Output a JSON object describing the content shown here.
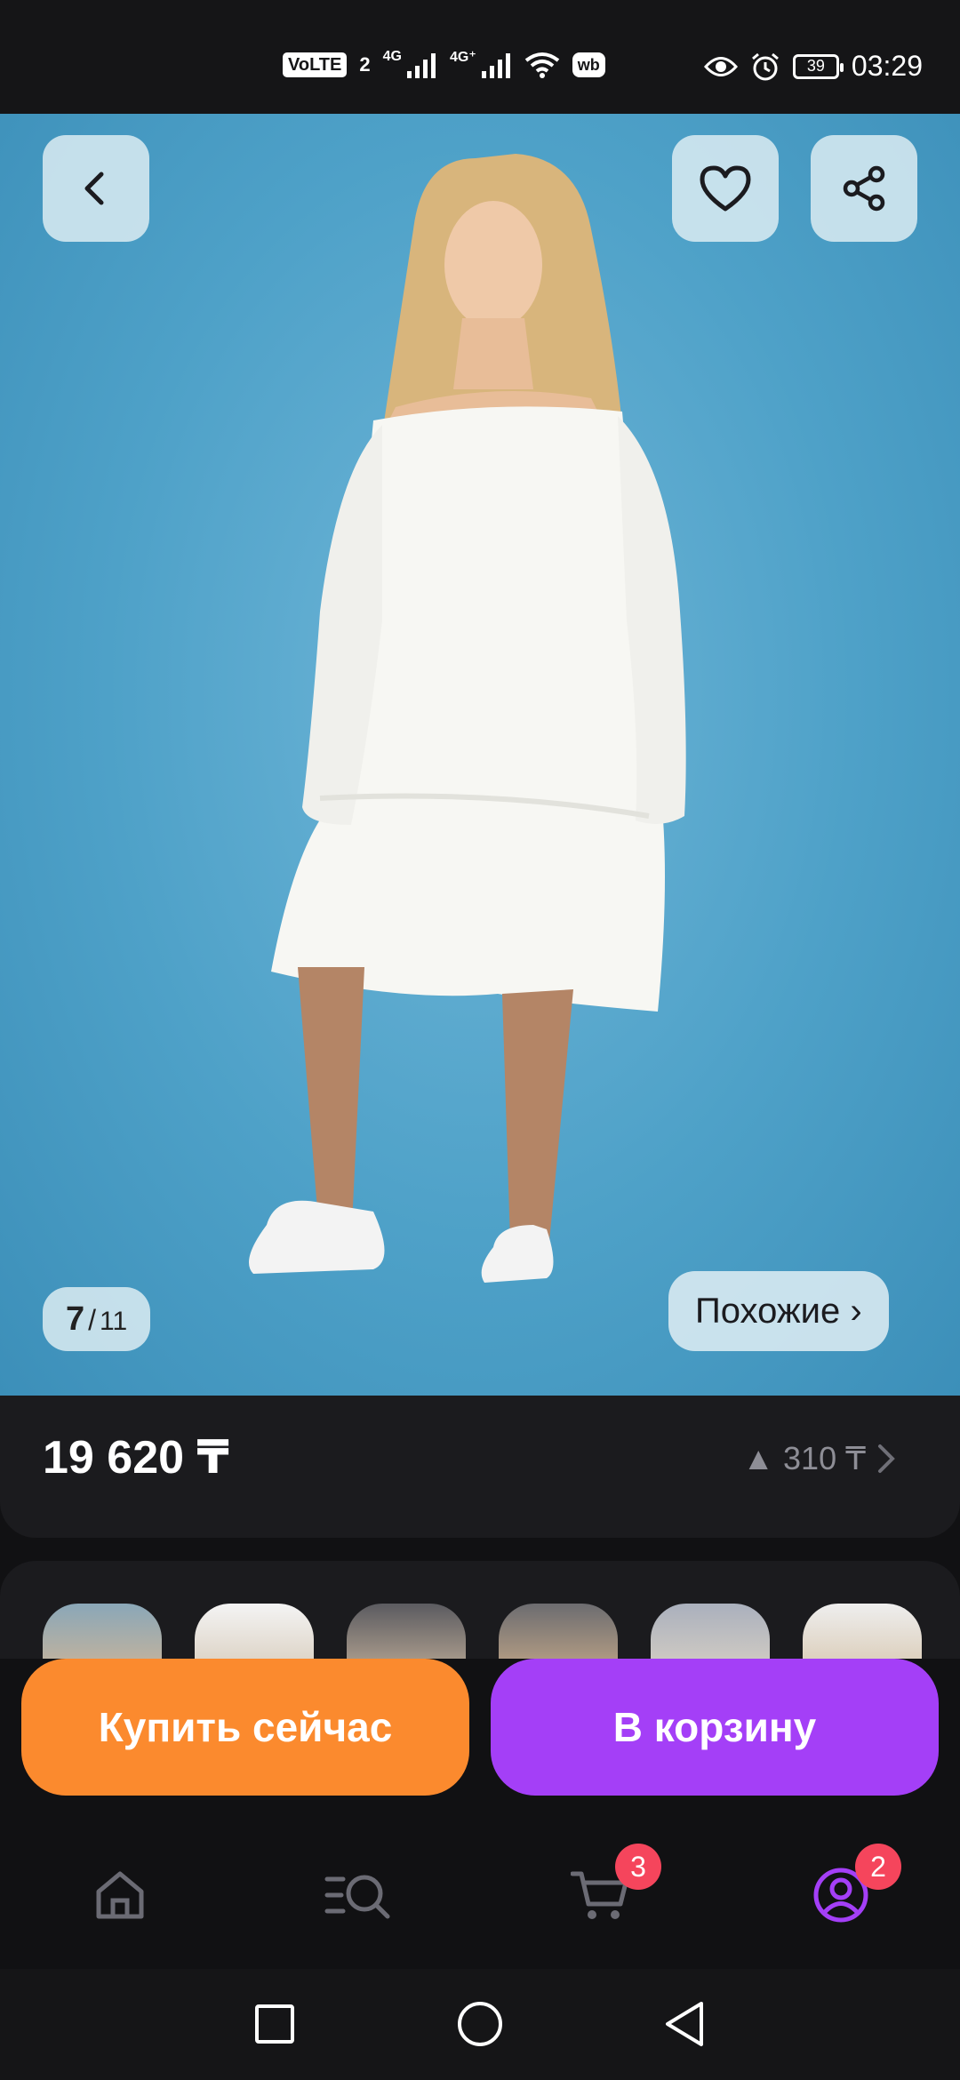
{
  "status_bar": {
    "volte": "VoLTE",
    "sim": "2",
    "net1": "4G",
    "net2": "4G⁺",
    "wb": "wb",
    "battery": "39",
    "time": "03:29"
  },
  "gallery": {
    "current": "7",
    "separator": "/",
    "total": "11",
    "similar_label": "Похожие ›"
  },
  "price": {
    "value": "19 620 ₸",
    "change": "▲ 310 ₸"
  },
  "actions": {
    "buy_now": "Купить сейчас",
    "to_cart": "В корзину"
  },
  "bottom_nav": {
    "cart_badge": "3",
    "profile_badge": "2"
  },
  "colors": {
    "buy_now": "#fb8a2e",
    "to_cart": "#a43ff7",
    "badge": "#f5455c",
    "profile_active": "#a43ff7"
  },
  "icons": [
    "back-icon",
    "heart-icon",
    "share-icon",
    "home-icon",
    "catalog-search-icon",
    "cart-icon",
    "profile-icon"
  ]
}
